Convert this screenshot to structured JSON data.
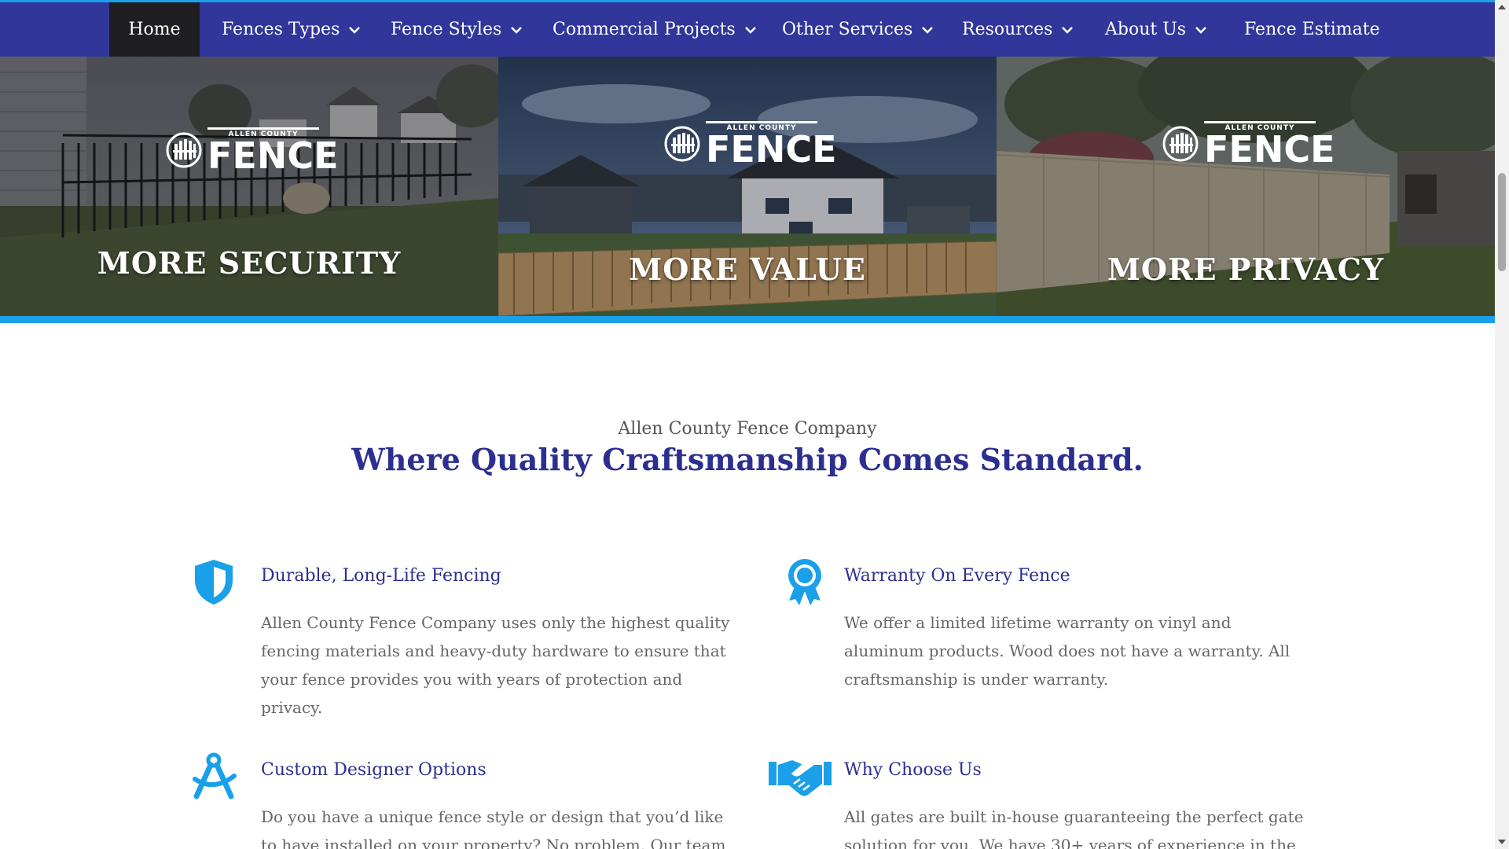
{
  "nav": {
    "items": [
      {
        "label": "Home",
        "has_dropdown": false,
        "active": true
      },
      {
        "label": "Fences Types",
        "has_dropdown": true
      },
      {
        "label": "Fence Styles",
        "has_dropdown": true
      },
      {
        "label": "Commercial Projects",
        "has_dropdown": true
      },
      {
        "label": "Other Services",
        "has_dropdown": true
      },
      {
        "label": "Resources",
        "has_dropdown": true
      },
      {
        "label": "About Us",
        "has_dropdown": true
      },
      {
        "label": "Fence Estimate",
        "has_dropdown": false
      }
    ]
  },
  "hero": {
    "logo_small": "ALLEN COUNTY",
    "logo_big": "FENCE",
    "panels": [
      {
        "caption": "MORE SECURITY"
      },
      {
        "caption": "MORE VALUE"
      },
      {
        "caption": "MORE PRIVACY"
      }
    ]
  },
  "intro": {
    "subtitle": "Allen County Fence Company",
    "title": "Where Quality Craftsmanship Comes Standard."
  },
  "features": [
    {
      "icon": "shield-icon",
      "title": "Durable, Long-Life Fencing",
      "text": "Allen County Fence Company uses only the highest quality fencing materials and heavy-duty hardware to ensure that your fence provides you with years of protection and privacy."
    },
    {
      "icon": "award-ribbon-icon",
      "title": "Warranty On Every Fence",
      "text": "We offer a limited lifetime warranty on vinyl and aluminum products. Wood does not have a warranty. All craftsmanship is under warranty."
    },
    {
      "icon": "drafting-compass-icon",
      "title": "Custom Designer Options",
      "text": "Do you have a unique fence style or design that you’d like to have installed on your property? No problem. Our team of experts can"
    },
    {
      "icon": "handshake-icon",
      "title": "Why Choose Us",
      "text": "All gates are built in-house guaranteeing the perfect gate solution for you. We have 30+ years of experience in the fence industry"
    }
  ],
  "colors": {
    "nav_bg": "#31369a",
    "accent_blue": "#1aa0e8",
    "heading_navy": "#2c2f8f",
    "active_nav_bg": "#1f1f22"
  }
}
